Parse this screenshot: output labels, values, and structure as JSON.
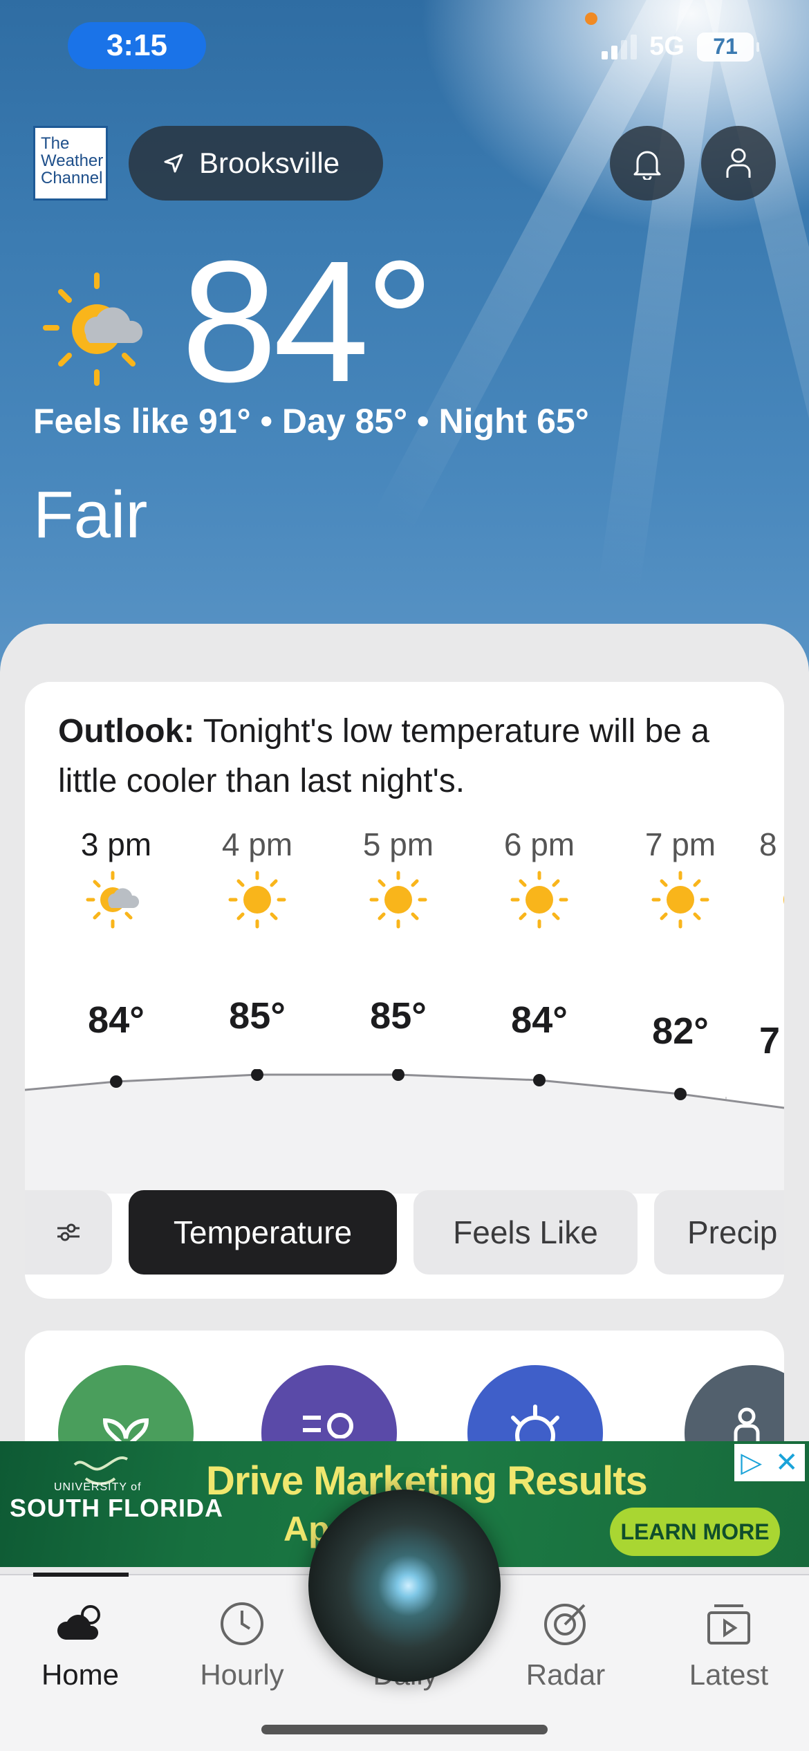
{
  "status_bar": {
    "time": "3:15",
    "network": "5G",
    "battery": "71"
  },
  "header": {
    "logo_lines": [
      "The",
      "Weather",
      "Channel"
    ],
    "location": "Brooksville",
    "icons": [
      "location-arrow-icon",
      "bell-icon",
      "profile-icon"
    ]
  },
  "current": {
    "temperature": "84°",
    "summary": "Feels like 91° • Day 85° • Night 65°",
    "condition": "Fair",
    "icon": "partly-sunny-icon"
  },
  "outlook": {
    "label": "Outlook:",
    "text": " Tonight's low temperature will be a little cooler than last night's."
  },
  "hourly": [
    {
      "time": "3 pm",
      "temp": "84°",
      "icon": "partly-sunny-icon"
    },
    {
      "time": "4 pm",
      "temp": "85°",
      "icon": "sun-icon"
    },
    {
      "time": "5 pm",
      "temp": "85°",
      "icon": "sun-icon"
    },
    {
      "time": "6 pm",
      "temp": "84°",
      "icon": "sun-icon"
    },
    {
      "time": "7 pm",
      "temp": "82°",
      "icon": "sun-icon"
    },
    {
      "time": "8",
      "temp": "7",
      "icon": "sun-icon"
    }
  ],
  "chips": {
    "settings_icon": "sliders-icon",
    "items": [
      "Temperature",
      "Feels Like",
      "Precip"
    ],
    "active": "Temperature"
  },
  "feature_circles": {
    "colors": [
      "#4a9e5c",
      "#5a4aa8",
      "#3f5fc9",
      "#52606d"
    ]
  },
  "ad": {
    "university_small": "UNIVERSITY of",
    "university": "SOUTH FLORIDA",
    "title": "Drive Marketing Results",
    "subtitle": "Ap        e 1",
    "cta": "LEARN MORE"
  },
  "tabs": [
    {
      "label": "Home",
      "icon": "cloud-icon"
    },
    {
      "label": "Hourly",
      "icon": "clock-icon"
    },
    {
      "label": "Daily",
      "icon": "calendar-icon"
    },
    {
      "label": "Radar",
      "icon": "radar-icon"
    },
    {
      "label": "Latest",
      "icon": "video-icon"
    }
  ],
  "colors": {
    "accent_blue": "#1a73e8",
    "sun_yellow": "#f9b51b",
    "active_chip": "#1f1f21"
  }
}
